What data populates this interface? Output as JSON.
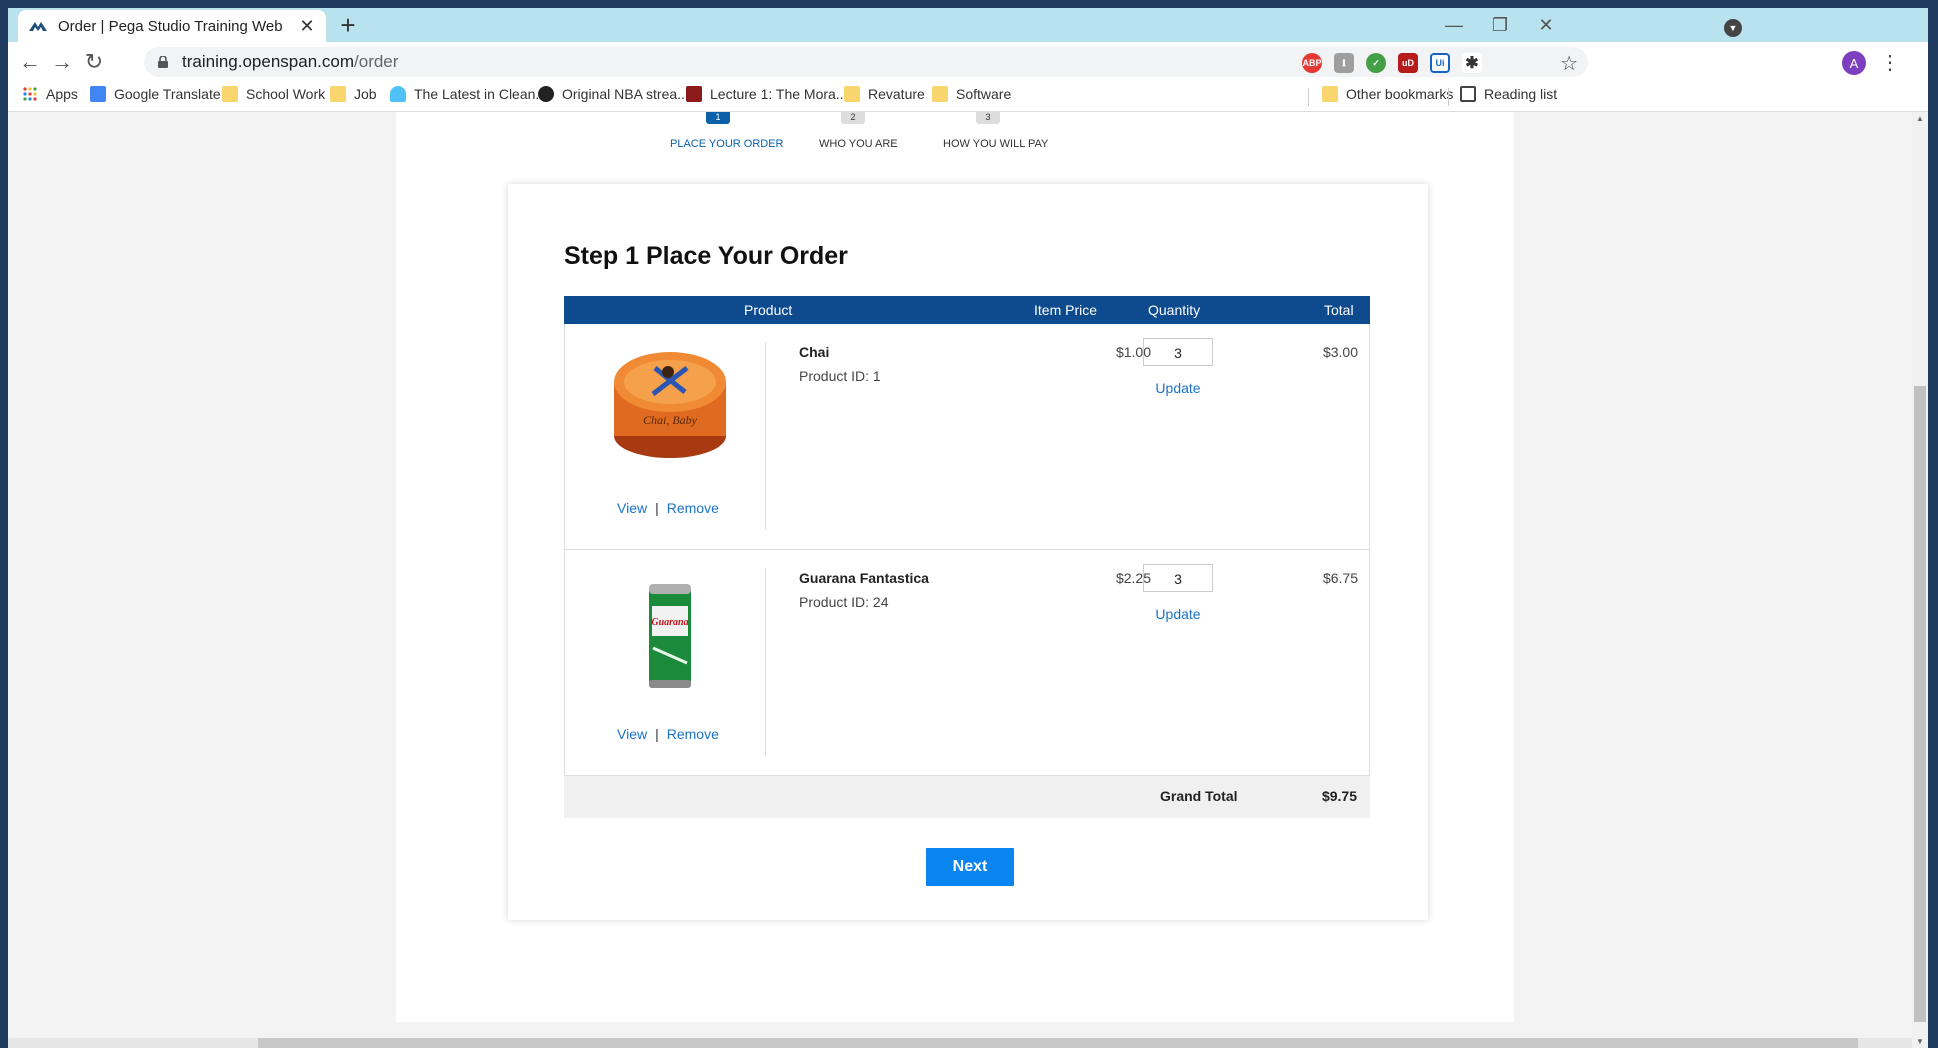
{
  "browser": {
    "tab_title": "Order | Pega Studio Training Web",
    "url_host": "training.openspan.com",
    "url_path": "/order",
    "avatar_letter": "A"
  },
  "bookmarks": [
    {
      "label": "Apps",
      "icon": "apps-grid-icon"
    },
    {
      "label": "Google Translate",
      "icon": "google-translate-icon"
    },
    {
      "label": "School Work",
      "icon": "folder-icon"
    },
    {
      "label": "Job",
      "icon": "folder-icon"
    },
    {
      "label": "The Latest in Clean...",
      "icon": "site-icon"
    },
    {
      "label": "Original NBA strea...",
      "icon": "globe-icon"
    },
    {
      "label": "Lecture 1: The Mora...",
      "icon": "site-icon"
    },
    {
      "label": "Revature",
      "icon": "folder-icon"
    },
    {
      "label": "Software",
      "icon": "folder-icon"
    },
    {
      "label": "Other bookmarks",
      "icon": "folder-icon"
    },
    {
      "label": "Reading list",
      "icon": "reading-list-icon"
    }
  ],
  "steps": [
    {
      "num": "1",
      "label": "PLACE YOUR ORDER",
      "active": true
    },
    {
      "num": "2",
      "label": "WHO YOU ARE",
      "active": false
    },
    {
      "num": "3",
      "label": "HOW YOU WILL PAY",
      "active": false
    }
  ],
  "order": {
    "heading": "Step 1 Place Your Order",
    "columns": {
      "product": "Product",
      "price": "Item Price",
      "quantity": "Quantity",
      "total": "Total"
    },
    "items": [
      {
        "name": "Chai",
        "product_id": "Product ID: 1",
        "price": "$1.00",
        "qty": "3",
        "total": "$3.00",
        "view": "View",
        "remove": "Remove",
        "update": "Update",
        "image_text": "Chai, Baby"
      },
      {
        "name": "Guarana Fantastica",
        "product_id": "Product ID: 24",
        "price": "$2.25",
        "qty": "3",
        "total": "$6.75",
        "view": "View",
        "remove": "Remove",
        "update": "Update",
        "image_text": "Guarana"
      }
    ],
    "separator": "|",
    "grand_total_label": "Grand Total",
    "grand_total": "$9.75",
    "next_label": "Next"
  },
  "colors": {
    "header_blue": "#0d4a8e",
    "link_blue": "#1a73c9",
    "next_button": "#0a84f0",
    "tab_strip": "#b8e3ee"
  }
}
